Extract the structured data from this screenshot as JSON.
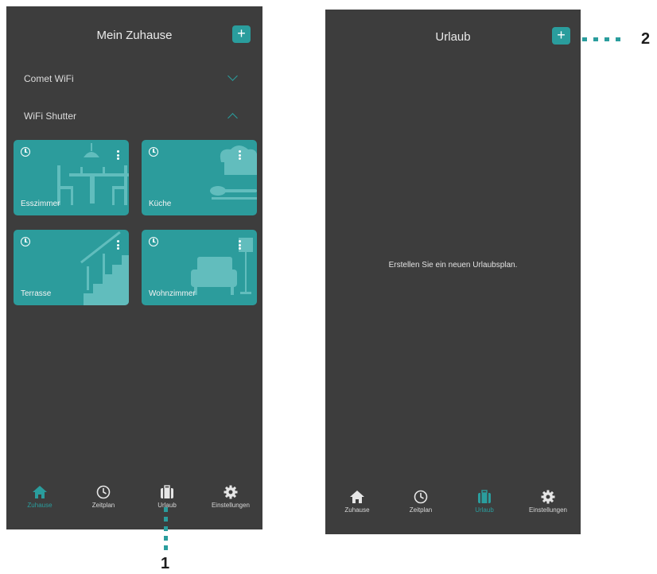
{
  "left_screen": {
    "title": "Mein Zuhause",
    "add_label": "+",
    "sections": [
      {
        "label": "Comet WiFi",
        "expanded": false
      },
      {
        "label": "WiFi Shutter",
        "expanded": true
      }
    ],
    "rooms": [
      {
        "name": "Esszimmer",
        "icon": "dining-room-icon"
      },
      {
        "name": "Küche",
        "icon": "kitchen-icon"
      },
      {
        "name": "Terrasse",
        "icon": "stairs-icon"
      },
      {
        "name": "Wohnzimmer",
        "icon": "living-room-icon"
      }
    ],
    "nav": [
      {
        "label": "Zuhause",
        "icon": "home-icon",
        "active": true
      },
      {
        "label": "Zeitplan",
        "icon": "clock-icon",
        "active": false
      },
      {
        "label": "Urlaub",
        "icon": "suitcase-icon",
        "active": false
      },
      {
        "label": "Einstellungen",
        "icon": "gear-icon",
        "active": false
      }
    ]
  },
  "right_screen": {
    "title": "Urlaub",
    "add_label": "+",
    "empty_message": "Erstellen Sie ein neuen Urlaubsplan.",
    "nav": [
      {
        "label": "Zuhause",
        "icon": "home-icon",
        "active": false
      },
      {
        "label": "Zeitplan",
        "icon": "clock-icon",
        "active": false
      },
      {
        "label": "Urlaub",
        "icon": "suitcase-icon",
        "active": true
      },
      {
        "label": "Einstellungen",
        "icon": "gear-icon",
        "active": false
      }
    ]
  },
  "callouts": [
    "1",
    "2"
  ],
  "colors": {
    "accent": "#2a9d9d",
    "screen_bg": "#3d3d3d",
    "tile_bg": "#2c9c9c"
  }
}
